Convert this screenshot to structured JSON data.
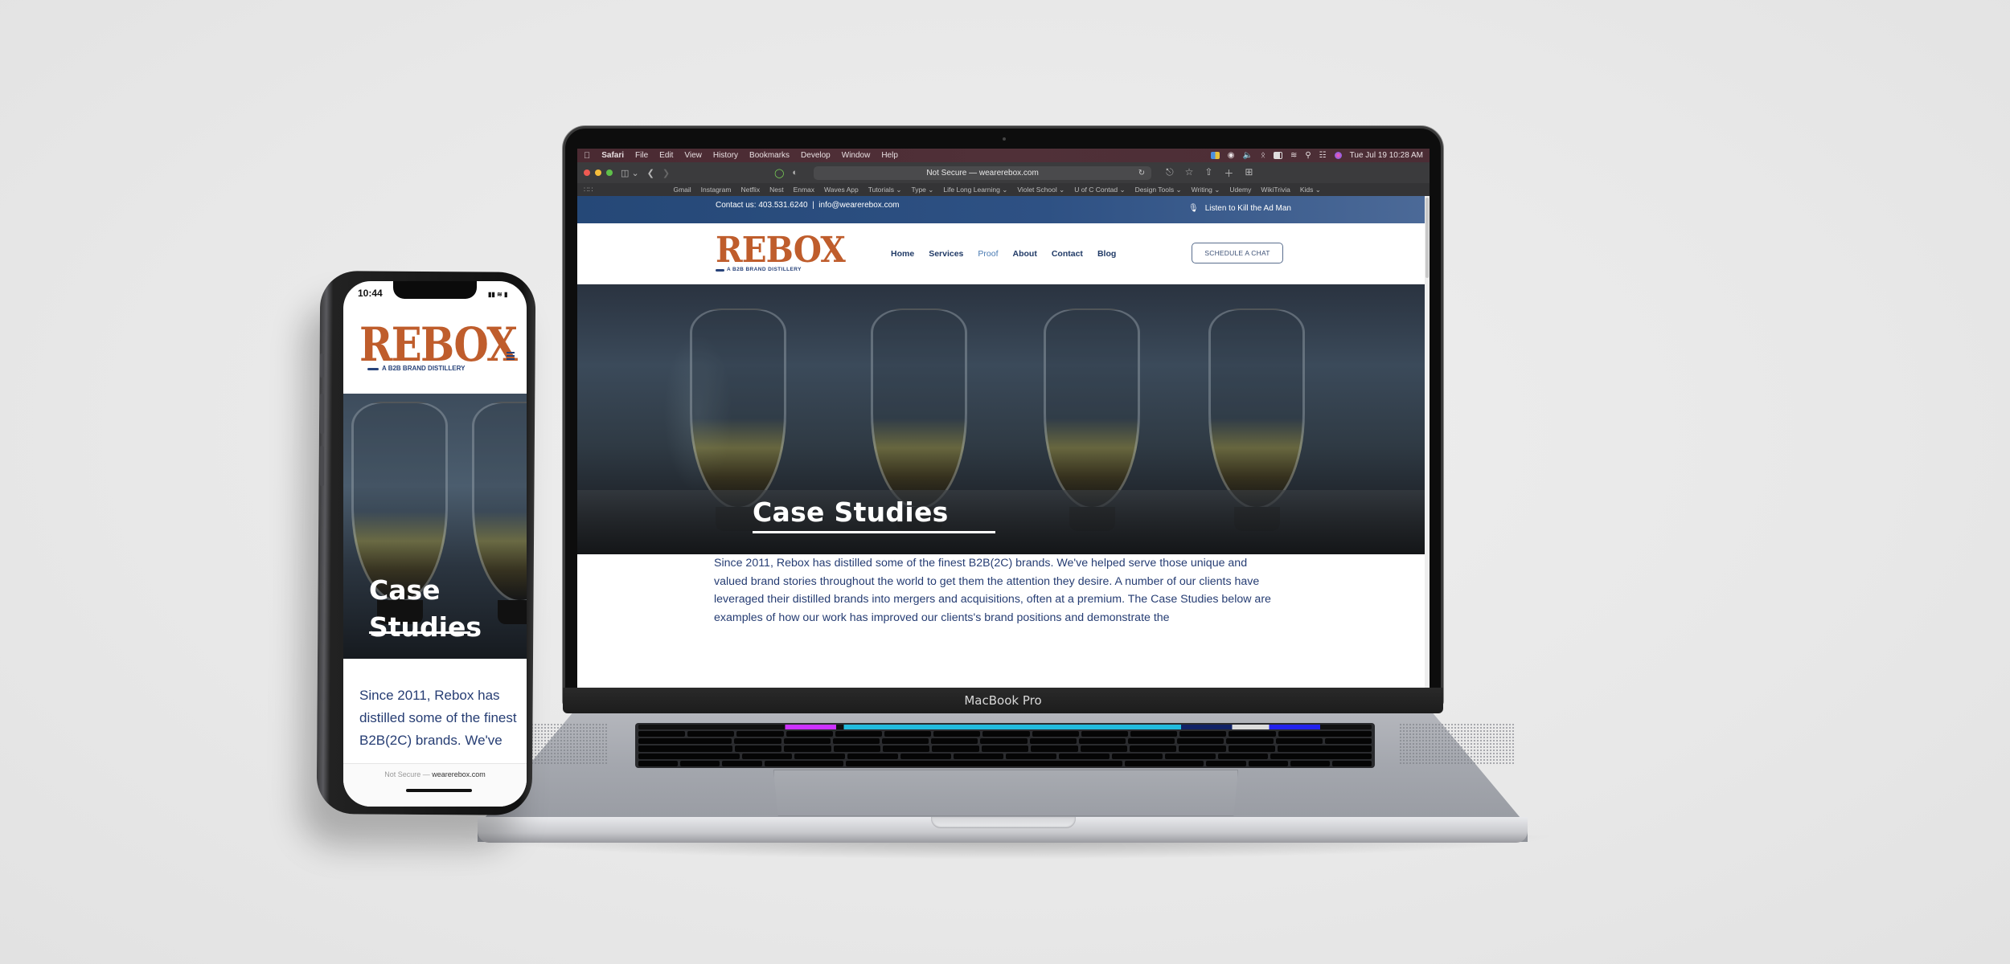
{
  "laptop": {
    "model_label": "MacBook Pro",
    "menubar": {
      "app": "Safari",
      "items": [
        "File",
        "Edit",
        "View",
        "History",
        "Bookmarks",
        "Develop",
        "Window",
        "Help"
      ],
      "clock": "Tue Jul 19  10:28 AM"
    },
    "safari": {
      "address": "Not Secure — wearerebox.com",
      "bookmarks": [
        "Gmail",
        "Instagram",
        "Netflix",
        "Nest",
        "Enmax",
        "Waves App",
        "Tutorials ⌄",
        "Type ⌄",
        "Life Long Learning ⌄",
        "Violet School ⌄",
        "U of C Contad ⌄",
        "Design Tools ⌄",
        "Writing ⌄",
        "Udemy",
        "WikiTrivia",
        "Kids ⌄"
      ]
    },
    "colors": {
      "close": "#ee5a52",
      "minimize": "#f4bd3b",
      "maximize": "#5fc04a"
    }
  },
  "site": {
    "topbar": {
      "contact_prefix": "Contact us:",
      "phone": "403.531.6240",
      "separator": "|",
      "email": "info@wearerebox.com",
      "podcast": "Listen to Kill the Ad Man"
    },
    "logo": {
      "word": "REBOX",
      "tagline": "A B2B BRAND DISTILLERY"
    },
    "nav": [
      {
        "label": "Home",
        "active": false
      },
      {
        "label": "Services",
        "active": false
      },
      {
        "label": "Proof",
        "active": true
      },
      {
        "label": "About",
        "active": false
      },
      {
        "label": "Contact",
        "active": false
      },
      {
        "label": "Blog",
        "active": false
      }
    ],
    "cta": "SCHEDULE A CHAT",
    "hero_title": "Case Studies",
    "intro": "Since 2011, Rebox has distilled some of the finest B2B(2C) brands. We've helped serve those unique and valued brand stories throughout the world to get them the attention they desire. A number of our clients have leveraged their distilled brands into mergers and acquisitions, often at a premium. The Case Studies below are examples of how our work has improved our clients's brand positions and demonstrate the",
    "colors": {
      "brand_orange": "#bf5d2c",
      "brand_navy": "#28437a",
      "topbar_blue": "#2e5184"
    }
  },
  "phone": {
    "time": "10:44",
    "logo": {
      "word": "REBOX",
      "tagline": "A B2B BRAND DISTILLERY"
    },
    "hero_title_line1": "Case",
    "hero_title_line2": "Studies",
    "intro": "Since 2011, Rebox has distilled some of the finest B2B(2C) brands. We've",
    "url_prefix": "Not Secure —",
    "url_domain": "wearerebox.com"
  }
}
